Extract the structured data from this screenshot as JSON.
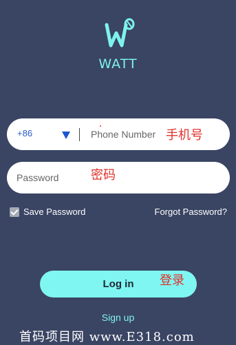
{
  "app": {
    "brand_name": "WATT",
    "logo_icon": "watt-w-logo-icon"
  },
  "colors": {
    "background": "#3a4463",
    "accent": "#7ff6f1",
    "annotation": "#e0302a"
  },
  "phone": {
    "country_code": "+86",
    "dropdown_icon": "caret-down-icon",
    "placeholder": "Phone Number",
    "annotation": "手机号"
  },
  "password": {
    "placeholder": "Password",
    "annotation": "密码"
  },
  "options": {
    "save_password_label": "Save Password",
    "save_password_checked": true,
    "forgot_password_label": "Forgot Password?"
  },
  "actions": {
    "login_label": "Log in",
    "login_annotation": "登录",
    "signup_label": "Sign up"
  },
  "watermark": "首码项目网 www.E318.com"
}
